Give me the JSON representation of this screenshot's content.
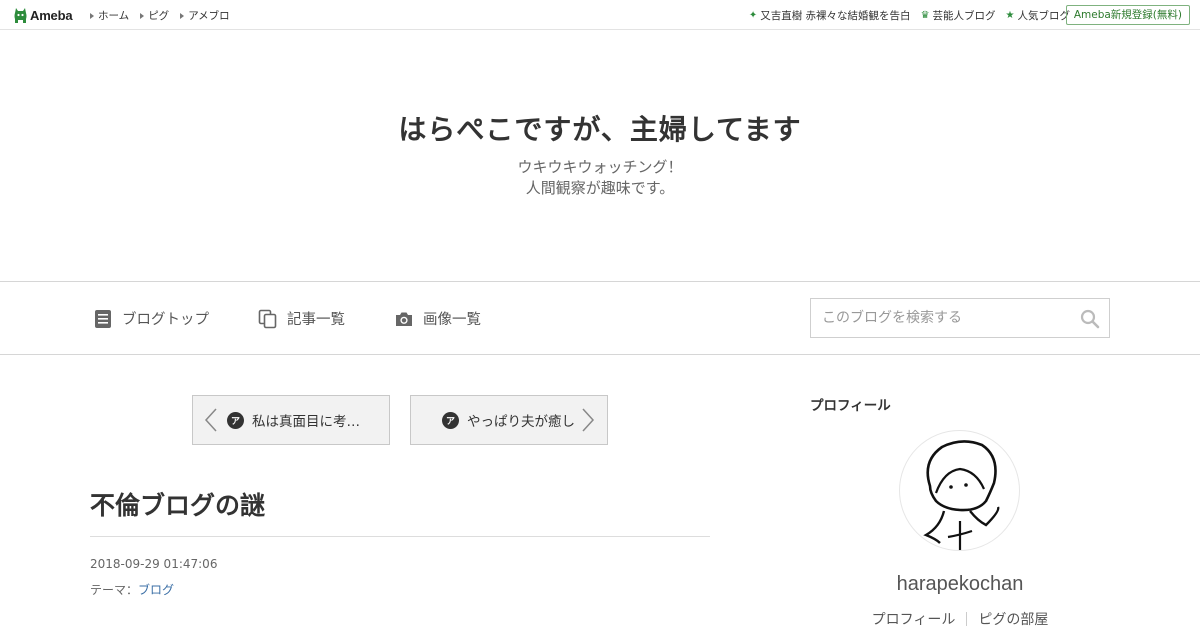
{
  "topbar": {
    "logo_text": "Ameba",
    "nav": [
      "ホーム",
      "ピグ",
      "アメブロ"
    ],
    "right_links": [
      {
        "label": "又吉直樹 赤裸々な結婚観を告白",
        "icon": "sparkle-icon"
      },
      {
        "label": "芸能人ブログ",
        "icon": "crown-icon"
      },
      {
        "label": "人気ブログ",
        "icon": "star-icon"
      }
    ],
    "signup_label": "Ameba新規登録(無料)"
  },
  "header": {
    "title": "はらぺこですが、主婦してます",
    "description_line1": "ウキウキウォッチング！",
    "description_line2": "人間観察が趣味です。"
  },
  "blognav": {
    "items": [
      "ブログトップ",
      "記事一覧",
      "画像一覧"
    ],
    "search_placeholder": "このブログを検索する"
  },
  "pager": {
    "prev_label": "私は真面目に考…",
    "next_label": "やっぱり夫が癒し",
    "icon_glyph": "ア"
  },
  "entry": {
    "title": "不倫ブログの謎",
    "date": "2018-09-29 01:47:06",
    "theme_prefix": "テーマ：",
    "theme_link": "ブログ"
  },
  "sidebar": {
    "heading": "プロフィール",
    "username": "harapekochan",
    "links": [
      "プロフィール",
      "ピグの部屋"
    ]
  },
  "colors": {
    "brand_green": "#2d8c3c",
    "link_blue": "#3a6ea5"
  }
}
